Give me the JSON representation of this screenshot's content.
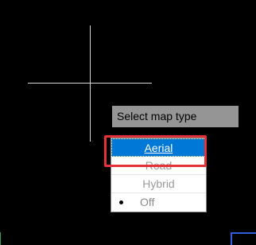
{
  "tooltip": {
    "title": "Select map type"
  },
  "menu": {
    "items": [
      {
        "label": "Aerial",
        "state": "selected"
      },
      {
        "label": "Road",
        "state": "normal"
      },
      {
        "label": "Hybrid",
        "state": "normal"
      },
      {
        "label": "Off",
        "state": "checked"
      }
    ]
  },
  "colors": {
    "background": "#000000",
    "tooltip_bg": "#959595",
    "selected_bg": "#0078d7",
    "highlight": "#e53238",
    "crosshair": "#d8d8d8"
  },
  "icons": {
    "cursor": "crosshair-icon",
    "check": "bullet-icon"
  }
}
